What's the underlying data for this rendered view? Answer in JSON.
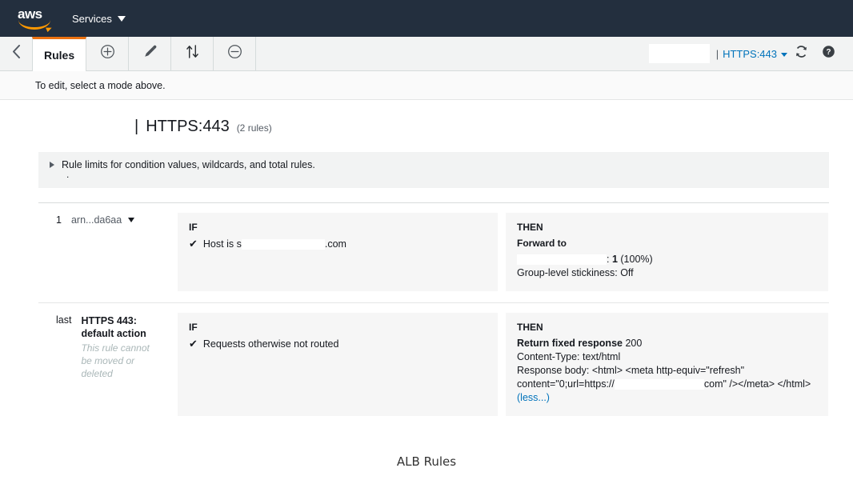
{
  "nav": {
    "logo_text": "aws",
    "services_label": "Services"
  },
  "toolbar": {
    "back_icon": "chevron-left-icon",
    "tab_label": "Rules",
    "add_icon": "plus-circle-icon",
    "edit_icon": "pencil-icon",
    "reorder_icon": "sort-updown-icon",
    "delete_icon": "minus-circle-icon",
    "search_value": "",
    "separator": "|",
    "listener_label": "HTTPS:443",
    "refresh_icon": "refresh-icon",
    "help_icon": "help-circle-icon"
  },
  "hint": {
    "text": "To edit, select a mode above."
  },
  "listener_header": {
    "separator": "|",
    "title": "HTTPS:443",
    "rule_count": "(2 rules)"
  },
  "limits": {
    "text": "Rule limits for condition values, wildcards, and total rules.",
    "bullet": "."
  },
  "rules": [
    {
      "index": "1",
      "arn": "arn...da6aa",
      "if": {
        "header": "IF",
        "condition_prefix": "Host is s",
        "condition_suffix": ".com"
      },
      "then": {
        "header": "THEN",
        "action": "Forward to",
        "target_separator": ": ",
        "weight": "1",
        "percent": "(100%)",
        "stickiness": "Group-level stickiness: Off"
      }
    },
    {
      "index": "last",
      "default_title": "HTTPS 443: default action",
      "default_note": "This rule cannot be moved or deleted",
      "if": {
        "header": "IF",
        "condition": "Requests otherwise not routed"
      },
      "then": {
        "header": "THEN",
        "action": "Return fixed response",
        "status_code": "200",
        "content_type": "Content-Type: text/html",
        "body_label": "Response body:",
        "body_part1": "<html> <meta http-equiv=\"refresh\" content=\"0;url=https://",
        "body_part2": "com\" /></meta> </html>",
        "toggle_link": "(less...)"
      }
    }
  ],
  "caption": {
    "text": "ALB Rules"
  },
  "colors": {
    "nav_bg": "#232f3e",
    "accent_orange": "#ec7211",
    "link_blue": "#0073bb",
    "panel_bg": "#f6f6f6"
  }
}
